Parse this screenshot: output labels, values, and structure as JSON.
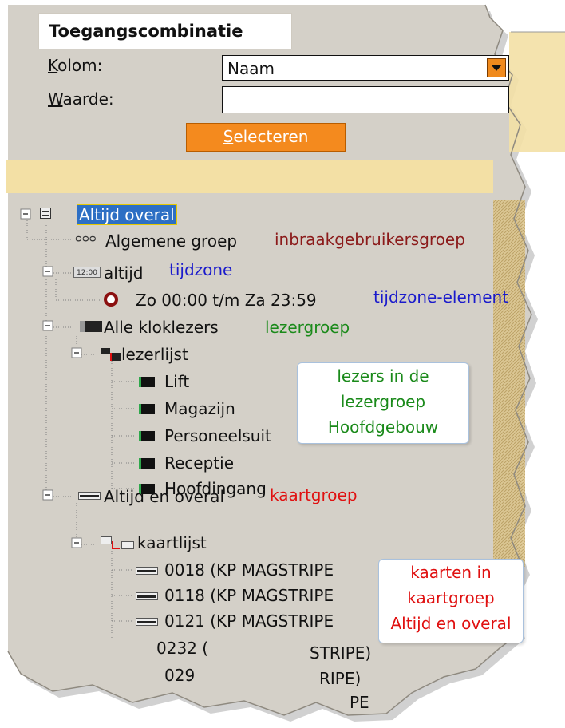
{
  "form": {
    "tab_title": "Toegangscombinatie",
    "kolom_label_first": "K",
    "kolom_label_rest": "olom:",
    "kolom_value": "Naam",
    "waarde_label_first": "W",
    "waarde_label_rest": "aarde:",
    "waarde_value": "",
    "select_button_first": "S",
    "select_button_rest": "electeren"
  },
  "tree": {
    "root": "Altijd overal",
    "group": "Algemene groep",
    "timezone": "altijd",
    "timezone_element": "Zo 00:00 t/m Za 23:59",
    "reader_group": "Alle kloklezers",
    "reader_list": "lezerlijst",
    "readers": [
      "Lift",
      "Magazijn",
      "Personeelsuit",
      "Receptie",
      "Hoofdingang"
    ],
    "card_group": "Altijd en overal",
    "card_list": "kaartlijst",
    "cards": [
      "0018 (KP MAGSTRIPE",
      "0118 (KP MAGSTRIPE",
      "0121 (KP MAGSTRIPE",
      "0232 (",
      "STRIPE)",
      "029",
      "RIPE)",
      "PE"
    ]
  },
  "annotations": {
    "group": "inbraakgebruikersgroep",
    "timezone": "tijdzone",
    "timezone_element": "tijdzone-element",
    "reader_group": "lezergroep",
    "card_group": "kaartgroep",
    "readers_callout": [
      "lezers in de",
      "lezergroep",
      "Hoofdgebouw"
    ],
    "cards_callout": [
      "kaarten in",
      "kaartgroep",
      "Altijd en overal"
    ]
  },
  "colors": {
    "panel_gray": "#d4d0c8",
    "band_tan": "#f3e0a5",
    "button_orange": "#f48a1e",
    "annotation_blue": "#1a1acc",
    "annotation_red": "#e01010",
    "annotation_green": "#1a8a1a",
    "annotation_darkred": "#8b1a1a"
  }
}
